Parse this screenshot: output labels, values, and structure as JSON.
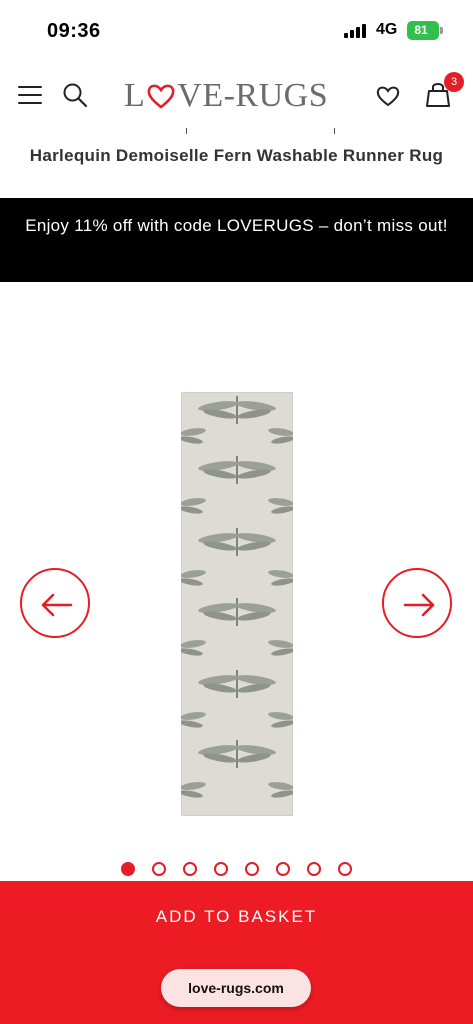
{
  "status_bar": {
    "time": "09:36",
    "network": "4G",
    "battery": "81"
  },
  "header": {
    "logo_text_left": "L",
    "logo_text_right": "VE-RUGS",
    "cart_count": "3",
    "icons": [
      "menu-icon",
      "search-icon",
      "heart-icon",
      "bag-icon"
    ]
  },
  "product": {
    "title": "Harlequin Demoiselle Fern Washable Runner Rug"
  },
  "promo": {
    "text": "Enjoy 11% off with code LOVERUGS – don’t miss out!"
  },
  "gallery": {
    "image_count": 8,
    "active_index": 0
  },
  "basket": {
    "label": "ADD TO BASKET"
  },
  "browser": {
    "url": "love-rugs.com"
  },
  "colors": {
    "brand_red": "#e41e26",
    "promo_bg": "#000000",
    "rug": "#dedad4",
    "dragonfly": "#8e948a"
  }
}
